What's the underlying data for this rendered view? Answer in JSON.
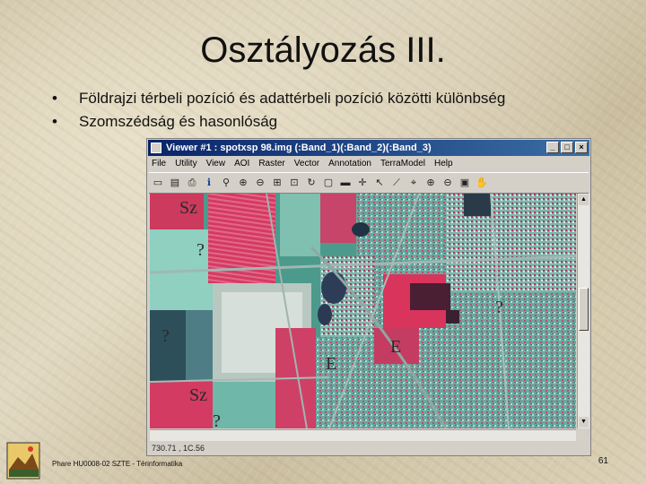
{
  "slide": {
    "title": "Osztályozás III.",
    "bullets": [
      "Földrajzi térbeli pozíció és adattérbeli pozíció közötti különbség",
      "Szomszédság és hasonlóság"
    ],
    "bullet_glyph": "•"
  },
  "viewer": {
    "window_title": "Viewer #1 : spotxsp 98.img (:Band_1)(:Band_2)(:Band_3)",
    "window_buttons": [
      "_",
      "□",
      "×"
    ],
    "menu": [
      "File",
      "Utility",
      "View",
      "AOI",
      "Raster",
      "Vector",
      "Annotation",
      "TerraModel",
      "Help"
    ],
    "toolbar_icons": [
      "open-icon",
      "save-icon",
      "print-icon",
      "info-icon",
      "magnifier-icon",
      "zoom-in-icon",
      "zoom-out-icon",
      "roam-icon",
      "pan-icon",
      "rotate-icon",
      "measure-icon",
      "line-icon",
      "crosshair-icon",
      "inquire-icon",
      "polyline-icon",
      "select-icon",
      "zoom-box-in-icon",
      "zoom-box-out-icon",
      "fit-icon",
      "hand-icon"
    ],
    "status_text": "730.71 , 1C.56",
    "map_labels": [
      {
        "text": "Sz"
      },
      {
        "text": "?"
      },
      {
        "text": "?"
      },
      {
        "text": "?"
      },
      {
        "text": "E"
      },
      {
        "text": "E"
      },
      {
        "text": "Sz"
      },
      {
        "text": "?"
      }
    ]
  },
  "footer": {
    "text": "Phare HU0008-02 SZTE - Térinformatika",
    "page_number": "61"
  }
}
